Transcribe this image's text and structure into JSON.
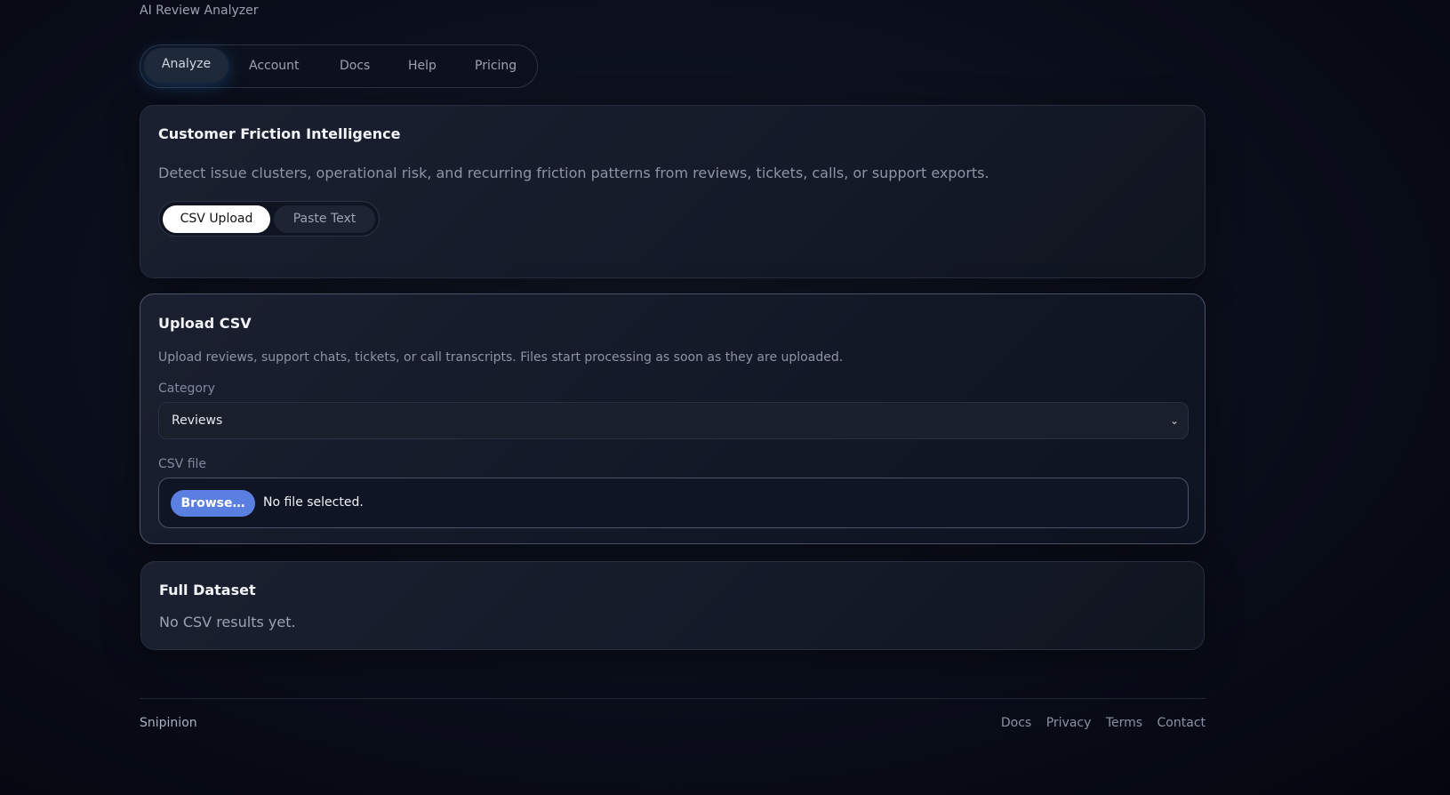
{
  "app_title": "AI Review Analyzer",
  "nav": {
    "tabs": [
      "Analyze",
      "Account",
      "Docs",
      "Help",
      "Pricing"
    ],
    "active": "Analyze"
  },
  "intro_card": {
    "title": "Customer Friction Intelligence",
    "description": "Detect issue clusters, operational risk, and recurring friction patterns from reviews, tickets, calls, or support exports.",
    "modes": [
      "CSV Upload",
      "Paste Text"
    ],
    "active_mode": "CSV Upload"
  },
  "upload_card": {
    "title": "Upload CSV",
    "description": "Upload reviews, support chats, tickets, or call transcripts. Files start processing as soon as they are uploaded.",
    "category_label": "Category",
    "category_value": "Reviews",
    "file_label": "CSV file",
    "browse_label": "Browse…",
    "file_status": "No file selected."
  },
  "dataset_card": {
    "title": "Full Dataset",
    "empty_text": "No CSV results yet."
  },
  "footer": {
    "brand": "Snipinion",
    "links": [
      "Docs",
      "Privacy",
      "Terms",
      "Contact"
    ]
  },
  "colors": {
    "accent": "#5b7fe0",
    "background": "#0a0e1a"
  }
}
